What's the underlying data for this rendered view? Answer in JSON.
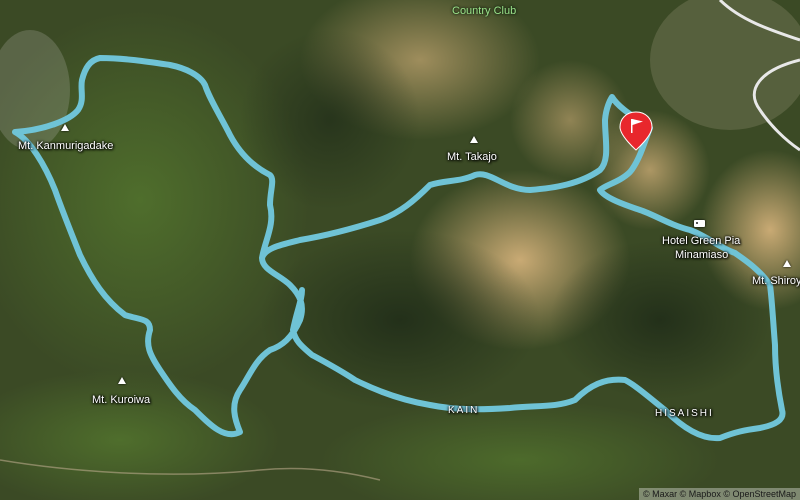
{
  "map": {
    "route_color": "#6fc3d6",
    "marker_color": "#e8272c",
    "peaks": [
      {
        "name": "Mt. Kanmurigadake"
      },
      {
        "name": "Mt. Takajo"
      },
      {
        "name": "Mt. Kuroiwa"
      },
      {
        "name": "Mt. Shiroy"
      }
    ],
    "places": {
      "country_club": "Country Club",
      "hotel": "Hotel Green Pia",
      "hotel_line2": "Minamiaso",
      "kain": "KAIN",
      "hisaishi": "HISAISHI"
    },
    "icons": {
      "peak": "peak-triangle-icon",
      "hotel": "hotel-icon",
      "finish": "flag-marker-icon"
    },
    "attribution": "© Maxar © Mapbox © OpenStreetMap"
  }
}
